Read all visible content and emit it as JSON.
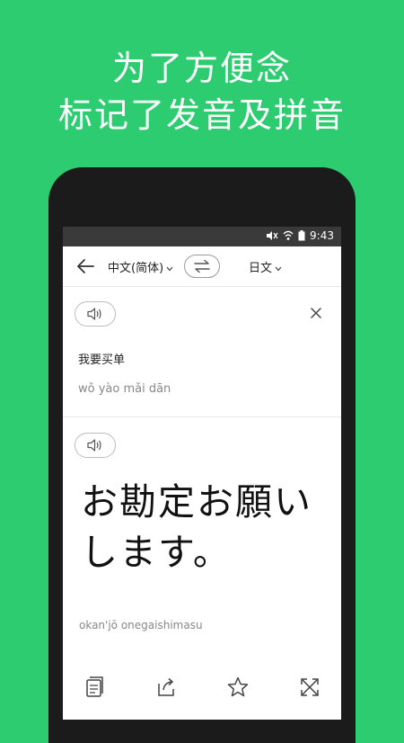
{
  "headline": {
    "line1": "为了方便念",
    "line2": "标记了发音及拼音"
  },
  "status_bar": {
    "time": "9:43",
    "icons": [
      "mute-icon",
      "wifi-icon",
      "battery-icon"
    ]
  },
  "toolbar": {
    "source_lang": "中文(简体)",
    "target_lang": "日文",
    "icons": [
      "back-arrow-icon",
      "swap-icon",
      "chevron-down-icon"
    ]
  },
  "source": {
    "text": "我要买单",
    "pinyin": "wǒ yào mǎi dān",
    "icons": [
      "speaker-icon",
      "close-icon"
    ]
  },
  "result": {
    "text": "お勘定お願いします。",
    "romaji": "okan'jō onegaishimasu",
    "icons": [
      "speaker-icon"
    ]
  },
  "actions": {
    "icons": [
      "copy-icon",
      "share-icon",
      "star-icon",
      "fullscreen-icon"
    ]
  },
  "colors": {
    "background": "#2ecc71",
    "phone_bezel": "#1b1b1b",
    "status_bar": "#3a3a3a"
  }
}
